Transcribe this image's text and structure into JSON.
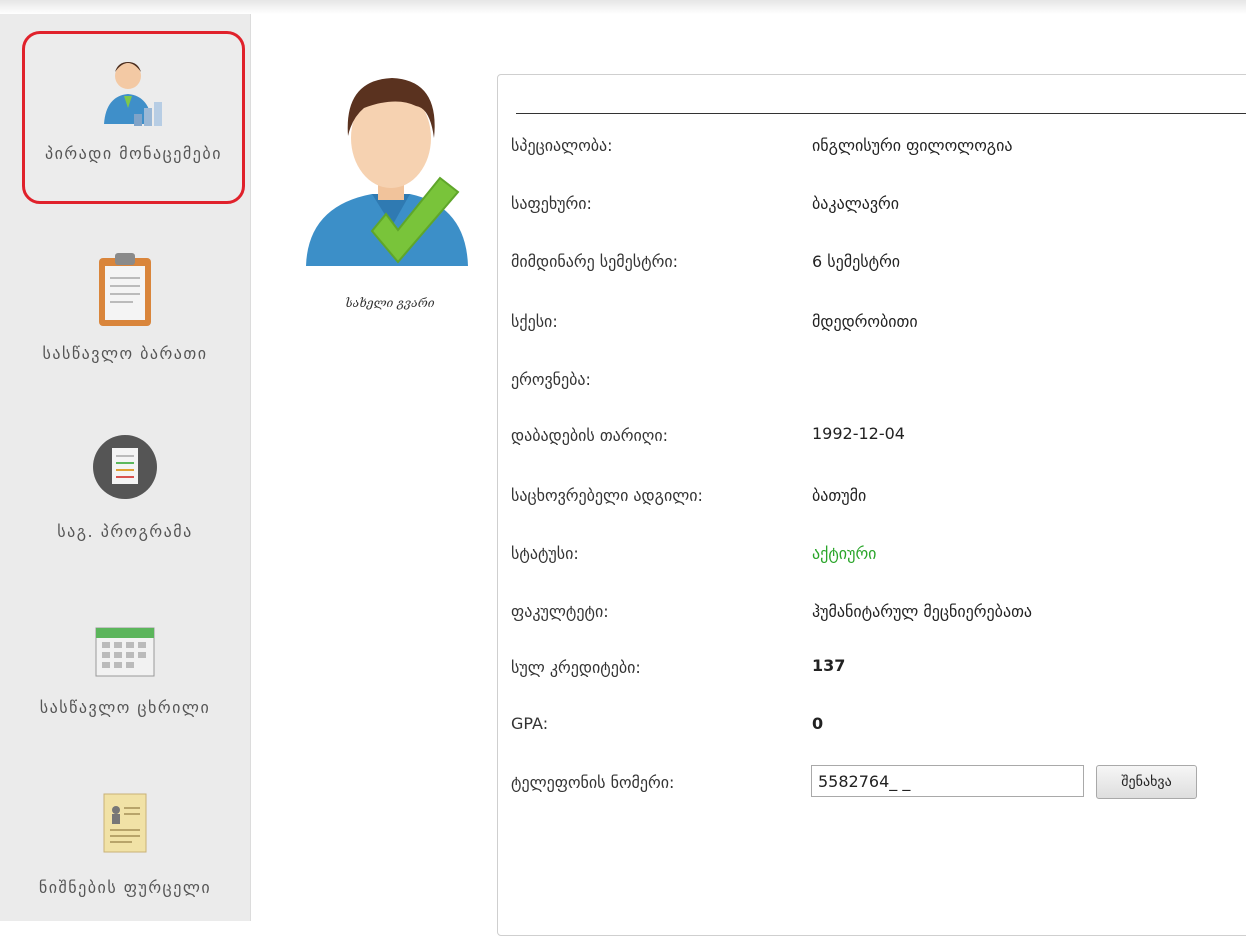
{
  "sidebar": {
    "items": [
      {
        "label": "პირადი მონაცემები",
        "icon": "person-chart-icon",
        "active": true
      },
      {
        "label": "სასწავლო ბარათი",
        "icon": "clipboard-icon",
        "active": false
      },
      {
        "label": "საგ. პროგრამა",
        "icon": "program-sheet-icon",
        "active": false
      },
      {
        "label": "სასწავლო ცხრილი",
        "icon": "calendar-icon",
        "active": false
      },
      {
        "label": "ნიშნების ფურცელი",
        "icon": "grade-sheet-icon",
        "active": false
      }
    ]
  },
  "profile": {
    "name": "სახელი გვარი",
    "avatar_icon": "user-verified-icon"
  },
  "details": {
    "rows": [
      {
        "label": "სპეციალობა:",
        "value": "ინგლისური ფილოლოგია"
      },
      {
        "label": "საფეხური:",
        "value": "ბაკალავრი"
      },
      {
        "label": "მიმდინარე სემესტრი:",
        "value": "6 სემესტრი"
      },
      {
        "label": "სქესი:",
        "value": "მდედრობითი"
      },
      {
        "label": "ეროვნება:",
        "value": ""
      },
      {
        "label": "დაბადების თარიღი:",
        "value": "1992-12-04"
      },
      {
        "label": "საცხოვრებელი ადგილი:",
        "value": "ბათუმი"
      },
      {
        "label": "სტატუსი:",
        "value": "აქტიური"
      },
      {
        "label": "ფაკულტეტი:",
        "value": "ჰუმანიტარულ მეცნიერებათა"
      },
      {
        "label": "სულ კრედიტები:",
        "value": "137"
      },
      {
        "label": "GPA:",
        "value": "0"
      }
    ],
    "phone": {
      "label": "ტელეფონის ნომერი:",
      "value": "5582764_ _",
      "save_label": "შენახვა"
    }
  },
  "colors": {
    "active_border": "#e0212b",
    "status_green": "#2aa52a",
    "sidebar_bg": "#ebebeb"
  }
}
